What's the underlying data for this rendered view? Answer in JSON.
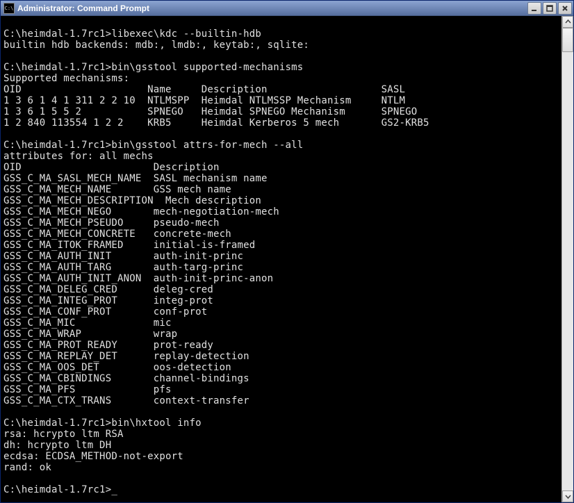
{
  "titlebar": {
    "icon_label": "C:\\",
    "title": "Administrator: Command Prompt"
  },
  "terminal": {
    "prompt": "C:\\heimdal-1.7rc1>",
    "cursor": "_",
    "blocks": [
      {
        "cmd": "libexec\\kdc --builtin-hdb",
        "out": [
          "builtin hdb backends: mdb:, lmdb:, keytab:, sqlite:"
        ]
      },
      {
        "cmd": "bin\\gsstool supported-mechanisms",
        "out": [
          "Supported mechanisms:",
          "OID                     Name     Description                   SASL",
          "1 3 6 1 4 1 311 2 2 10  NTLMSPP  Heimdal NTLMSSP Mechanism     NTLM",
          "1 3 6 1 5 5 2           SPNEGO   Heimdal SPNEGO Mechanism      SPNEGO",
          "1 2 840 113554 1 2 2    KRB5     Heimdal Kerberos 5 mech       GS2-KRB5"
        ]
      },
      {
        "cmd": "bin\\gsstool attrs-for-mech --all",
        "out": [
          "attributes for: all mechs",
          "OID                      Description",
          "GSS_C_MA_SASL_MECH_NAME  SASL mechanism name",
          "GSS_C_MA_MECH_NAME       GSS mech name",
          "GSS_C_MA_MECH_DESCRIPTION  Mech description",
          "GSS_C_MA_MECH_NEGO       mech-negotiation-mech",
          "GSS_C_MA_MECH_PSEUDO     pseudo-mech",
          "GSS_C_MA_MECH_CONCRETE   concrete-mech",
          "GSS_C_MA_ITOK_FRAMED     initial-is-framed",
          "GSS_C_MA_AUTH_INIT       auth-init-princ",
          "GSS_C_MA_AUTH_TARG       auth-targ-princ",
          "GSS_C_MA_AUTH_INIT_ANON  auth-init-princ-anon",
          "GSS_C_MA_DELEG_CRED      deleg-cred",
          "GSS_C_MA_INTEG_PROT      integ-prot",
          "GSS_C_MA_CONF_PROT       conf-prot",
          "GSS_C_MA_MIC             mic",
          "GSS_C_MA_WRAP            wrap",
          "GSS_C_MA_PROT_READY      prot-ready",
          "GSS_C_MA_REPLAY_DET      replay-detection",
          "GSS_C_MA_OOS_DET         oos-detection",
          "GSS_C_MA_CBINDINGS       channel-bindings",
          "GSS_C_MA_PFS             pfs",
          "GSS_C_MA_CTX_TRANS       context-transfer"
        ]
      },
      {
        "cmd": "bin\\hxtool info",
        "out": [
          "rsa: hcrypto ltm RSA",
          "dh: hcrypto ltm DH",
          "ecdsa: ECDSA_METHOD-not-export",
          "rand: ok"
        ]
      }
    ]
  }
}
